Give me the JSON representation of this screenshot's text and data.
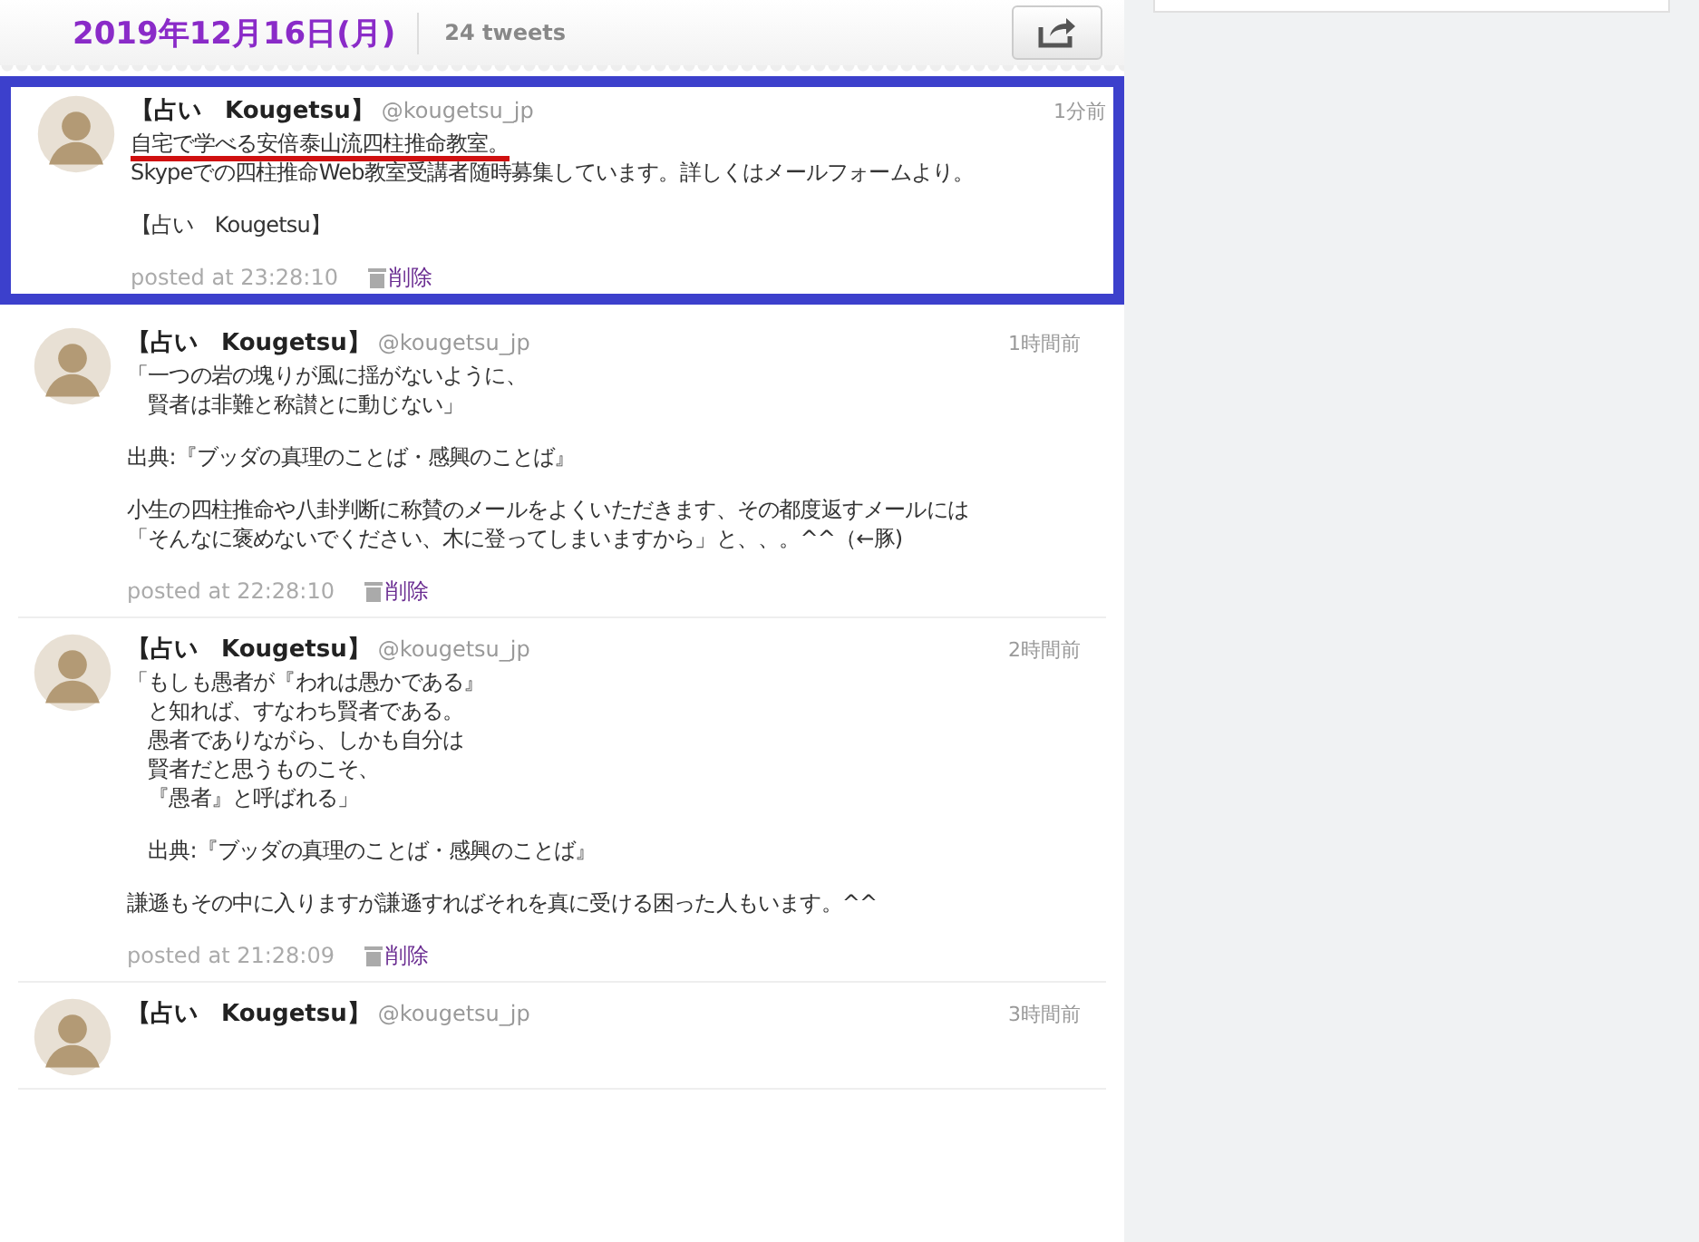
{
  "header": {
    "date": "2019年12月16日(月)",
    "count": "24 tweets"
  },
  "tweets": [
    {
      "name": "【占い　Kougetsu】",
      "handle": "@kougetsu_jp",
      "time": "1分前",
      "highlighted": true,
      "paragraphs": [
        [
          {
            "text": "自宅で学べる安倍泰山流四柱推命教室。",
            "underlined": true
          },
          {
            "text": "Skypeでの四柱推命Web教室受講者随時募集しています。詳しくはメールフォームより。",
            "underlined": false
          }
        ],
        [
          {
            "text": "【占い　Kougetsu】",
            "underlined": false
          }
        ]
      ],
      "posted": "posted at 23:28:10",
      "delete": "削除"
    },
    {
      "name": "【占い　Kougetsu】",
      "handle": "@kougetsu_jp",
      "time": "1時間前",
      "highlighted": false,
      "paragraphs": [
        [
          {
            "text": "「一つの岩の塊りが風に揺がないように、",
            "underlined": false
          },
          {
            "text": "　賢者は非難と称讃とに動じない」",
            "underlined": false
          }
        ],
        [
          {
            "text": "出典:『ブッダの真理のことば・感興のことば』",
            "underlined": false
          }
        ],
        [
          {
            "text": "小生の四柱推命や八卦判断に称賛のメールをよくいただきます、その都度返すメールには",
            "underlined": false
          },
          {
            "text": "「そんなに褒めないでください、木に登ってしまいますから」と、、。^^（←豚)",
            "underlined": false
          }
        ]
      ],
      "posted": "posted at 22:28:10",
      "delete": "削除"
    },
    {
      "name": "【占い　Kougetsu】",
      "handle": "@kougetsu_jp",
      "time": "2時間前",
      "highlighted": false,
      "paragraphs": [
        [
          {
            "text": "「もしも愚者が『われは愚かである』",
            "underlined": false
          },
          {
            "text": "　と知れば、すなわち賢者である。",
            "underlined": false
          },
          {
            "text": "　愚者でありながら、しかも自分は",
            "underlined": false
          },
          {
            "text": "　賢者だと思うものこそ、",
            "underlined": false
          },
          {
            "text": "　『愚者』と呼ばれる」",
            "underlined": false
          }
        ],
        [
          {
            "text": "　出典:『ブッダの真理のことば・感興のことば』",
            "underlined": false
          }
        ],
        [
          {
            "text": "謙遜もその中に入りますが謙遜すればそれを真に受ける困った人もいます。^^",
            "underlined": false
          }
        ]
      ],
      "posted": "posted at 21:28:09",
      "delete": "削除"
    },
    {
      "name": "【占い　Kougetsu】",
      "handle": "@kougetsu_jp",
      "time": "3時間前",
      "highlighted": false
    }
  ]
}
